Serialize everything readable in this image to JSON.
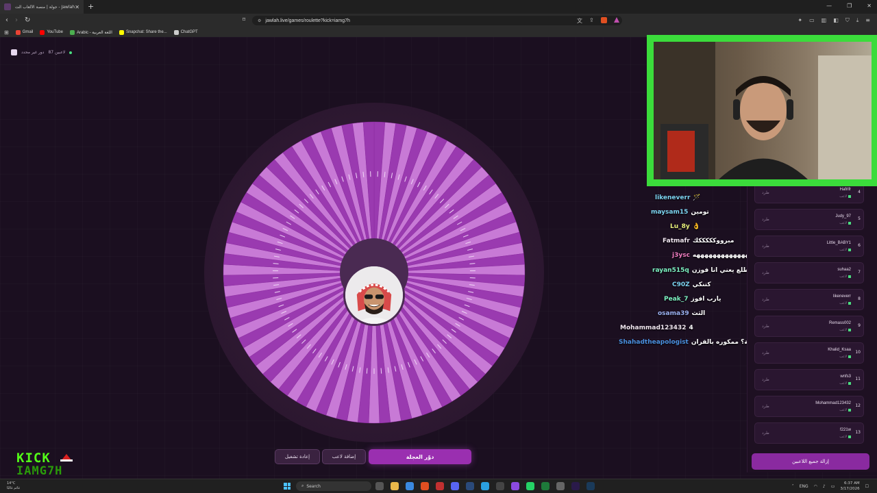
{
  "browser": {
    "tab_title": "جولة | منصة الألعاب الت - Jawlah",
    "url": "jawlah.live/games/roulette?kick=iamg7h",
    "bookmarks": [
      {
        "label": "Gmail",
        "color": "#ea4335"
      },
      {
        "label": "YouTube",
        "color": "#ff0000"
      },
      {
        "label": "Arabic - اللغة العربية",
        "color": "#4caf50"
      },
      {
        "label": "Snapchat: Share the...",
        "color": "#fffc00"
      },
      {
        "label": "ChatGPT",
        "color": "#cccccc"
      }
    ]
  },
  "game": {
    "status": "دور غير محدد",
    "players_count": "87 لاعبين",
    "buttons": {
      "reset": "إعادة تشغيل",
      "add_player": "إضافة لاعب",
      "spin": "دوّر العجلة"
    },
    "wheel_color_a": "#9a3ab0",
    "wheel_color_b": "#c87ad6"
  },
  "kick": {
    "line1": "KICK",
    "line2": "IAMG7H"
  },
  "chat": [
    {
      "user": "likeneverr",
      "text": "🪄",
      "color": "#7cd3f0"
    },
    {
      "user": "maysam15",
      "text": "تومين",
      "color": "#7cd3f0"
    },
    {
      "user": "Lu_8y",
      "text": "👌",
      "color": "#e8f07c"
    },
    {
      "user": "Fatmafr",
      "text": "مبرووكككككك",
      "color": "#f0e6f0"
    },
    {
      "user": "j3ysc",
      "text": "ههههههههههههههههه",
      "color": "#f07cc0"
    },
    {
      "user": "rayan515q",
      "text": "يخوي ترى بطلع يعني انا فوزن",
      "color": "#7cf0c0"
    },
    {
      "user": "C90Z",
      "text": "كتنكي",
      "color": "#7cd3f0"
    },
    {
      "user": "Peak_7",
      "text": "يارب افوز",
      "color": "#7cf0c0"
    },
    {
      "user": "osama39",
      "text": "الثث",
      "color": "#9ab0f0"
    },
    {
      "user": "Mohammad123432",
      "text": "4",
      "color": "#f0e6f0"
    },
    {
      "user": "Shahadtheapologist",
      "text": "والكرامة؟ ممكوره بالقران",
      "color": "#4a90e0"
    }
  ],
  "players": [
    {
      "rank": "4",
      "name": "Hafrifr",
      "sub": "لاعب",
      "action": "طرد"
    },
    {
      "rank": "5",
      "name": "Judy_97",
      "sub": "لاعب",
      "action": "طرد"
    },
    {
      "rank": "6",
      "name": "Little_BABY1",
      "sub": "لاعب",
      "action": "طرد"
    },
    {
      "rank": "7",
      "name": "suhaa2",
      "sub": "لاعب",
      "action": "طرد"
    },
    {
      "rank": "8",
      "name": "likeneverr",
      "sub": "لاعب",
      "action": "طرد"
    },
    {
      "rank": "9",
      "name": "Remass002",
      "sub": "لاعب",
      "action": "طرد"
    },
    {
      "rank": "10",
      "name": "Khalid_Ksaa",
      "sub": "لاعب",
      "action": "طرد"
    },
    {
      "rank": "11",
      "name": "wnfs3",
      "sub": "لاعب",
      "action": "طرد"
    },
    {
      "rank": "12",
      "name": "Mohammad123432",
      "sub": "لاعب",
      "action": "طرد"
    },
    {
      "rank": "13",
      "name": "f221w",
      "sub": "لاعب",
      "action": "طرد"
    }
  ],
  "sidebar": {
    "clear_all": "إزالة جميع اللاعبين"
  },
  "taskbar": {
    "weather": "14°C",
    "weather_text": "غائم غالبًا",
    "search": "Search",
    "lang": "ENG",
    "time": "6:37 AM",
    "date": "3/17/2026"
  }
}
